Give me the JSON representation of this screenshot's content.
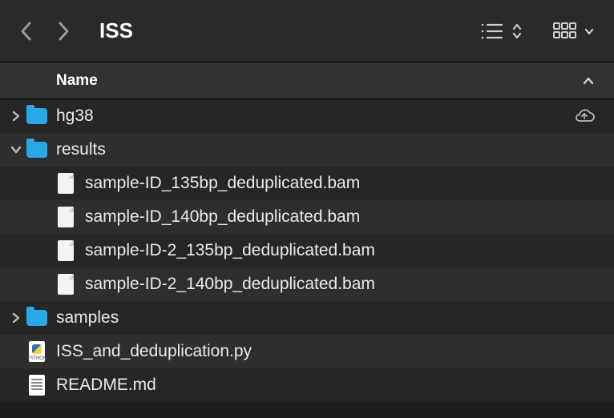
{
  "toolbar": {
    "title": "ISS"
  },
  "columns": {
    "name": "Name"
  },
  "items": [
    {
      "kind": "folder",
      "name": "hg38",
      "depth": 0,
      "expanded": false,
      "cloud": true
    },
    {
      "kind": "folder",
      "name": "results",
      "depth": 0,
      "expanded": true,
      "cloud": false
    },
    {
      "kind": "file",
      "name": "sample-ID_135bp_deduplicated.bam",
      "depth": 1,
      "icon": "blank"
    },
    {
      "kind": "file",
      "name": "sample-ID_140bp_deduplicated.bam",
      "depth": 1,
      "icon": "blank"
    },
    {
      "kind": "file",
      "name": "sample-ID-2_135bp_deduplicated.bam",
      "depth": 1,
      "icon": "blank"
    },
    {
      "kind": "file",
      "name": "sample-ID-2_140bp_deduplicated.bam",
      "depth": 1,
      "icon": "blank"
    },
    {
      "kind": "folder",
      "name": "samples",
      "depth": 0,
      "expanded": false,
      "cloud": false
    },
    {
      "kind": "file",
      "name": "ISS_and_deduplication.py",
      "depth": 0,
      "icon": "python"
    },
    {
      "kind": "file",
      "name": "README.md",
      "depth": 0,
      "icon": "markdown"
    }
  ]
}
